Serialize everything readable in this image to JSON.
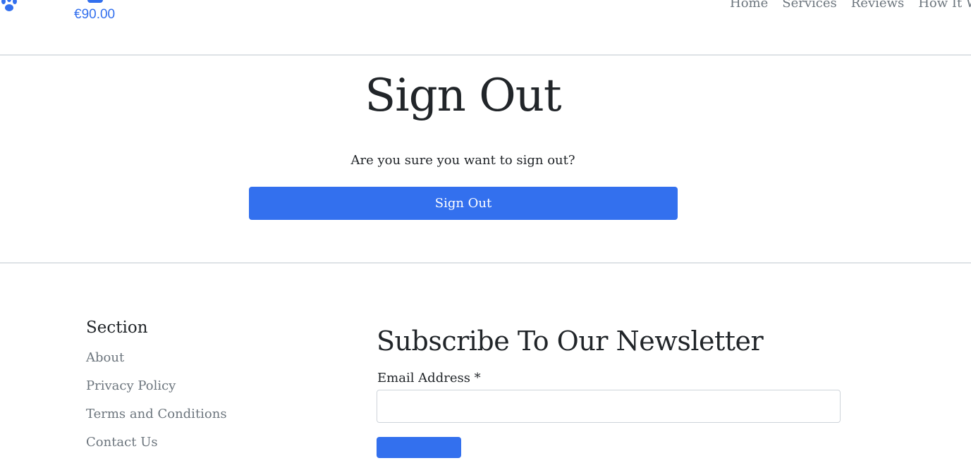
{
  "header": {
    "logo_icon": "paw-icon",
    "cart_icon": "cart-icon",
    "cart_total": "€90.00",
    "nav": [
      {
        "label": "Home"
      },
      {
        "label": "Services"
      },
      {
        "label": "Reviews"
      },
      {
        "label": "How It W"
      }
    ]
  },
  "main": {
    "title": "Sign Out",
    "confirm_text": "Are you sure you want to sign out?",
    "signout_button_label": "Sign Out"
  },
  "footer": {
    "section_title": "Section",
    "links": [
      {
        "label": "About"
      },
      {
        "label": "Privacy Policy"
      },
      {
        "label": "Terms and Conditions"
      },
      {
        "label": "Contact Us"
      }
    ],
    "newsletter": {
      "title": "Subscribe To Our Newsletter",
      "email_label": "Email Address *",
      "email_value": ""
    }
  },
  "colors": {
    "accent": "#3370ee",
    "muted_text": "#6c757d",
    "text": "#212529",
    "divider": "#dee2e6"
  }
}
